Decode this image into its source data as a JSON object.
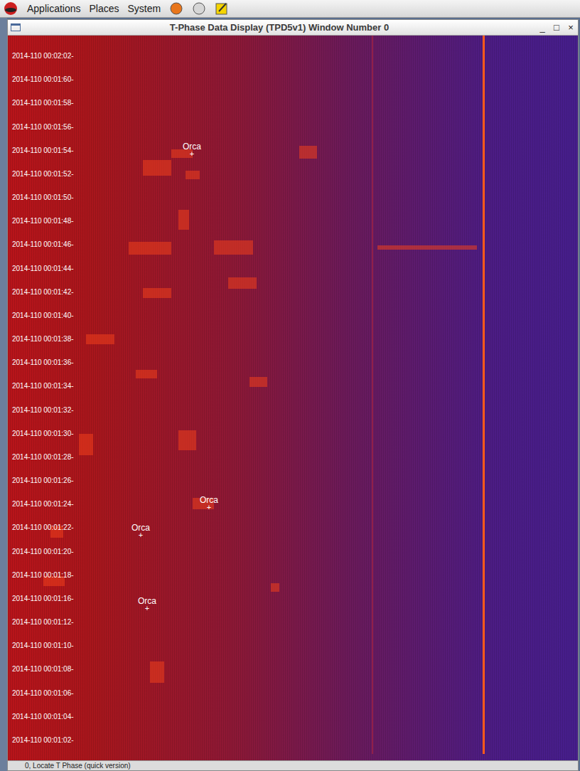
{
  "top_panel": {
    "menus": [
      {
        "label": "Applications"
      },
      {
        "label": "Places"
      },
      {
        "label": "System"
      }
    ]
  },
  "window": {
    "title": "T-Phase Data Display (TPD5v1) Window Number 0",
    "controls": [
      "_",
      "□",
      "×"
    ]
  },
  "spectrogram": {
    "time_labels": [
      "2014-110 00:02:02",
      "2014-110 00:01:60",
      "2014-110 00:01:58",
      "2014-110 00:01:56",
      "2014-110 00:01:54",
      "2014-110 00:01:52",
      "2014-110 00:01:50",
      "2014-110 00:01:48",
      "2014-110 00:01:46",
      "2014-110 00:01:44",
      "2014-110 00:01:42",
      "2014-110 00:01:40",
      "2014-110 00:01:38",
      "2014-110 00:01:36",
      "2014-110 00:01:34",
      "2014-110 00:01:32",
      "2014-110 00:01:30",
      "2014-110 00:01:28",
      "2014-110 00:01:26",
      "2014-110 00:01:24",
      "2014-110 00:01:22",
      "2014-110 00:01:20",
      "2014-110 00:01:18",
      "2014-110 00:01:16",
      "2014-110 00:01:12",
      "2014-110 00:01:10",
      "2014-110 00:01:08",
      "2014-110 00:01:06",
      "2014-110 00:01:04",
      "2014-110 00:01:02"
    ],
    "detections": [
      {
        "label": "Orca",
        "marker": "+"
      },
      {
        "label": "Orca",
        "marker": "+"
      },
      {
        "label": "Orca",
        "marker": "+"
      },
      {
        "label": "Orca",
        "marker": "+"
      }
    ]
  },
  "status_bar": {
    "text": "0, Locate T Phase (quick version)"
  }
}
